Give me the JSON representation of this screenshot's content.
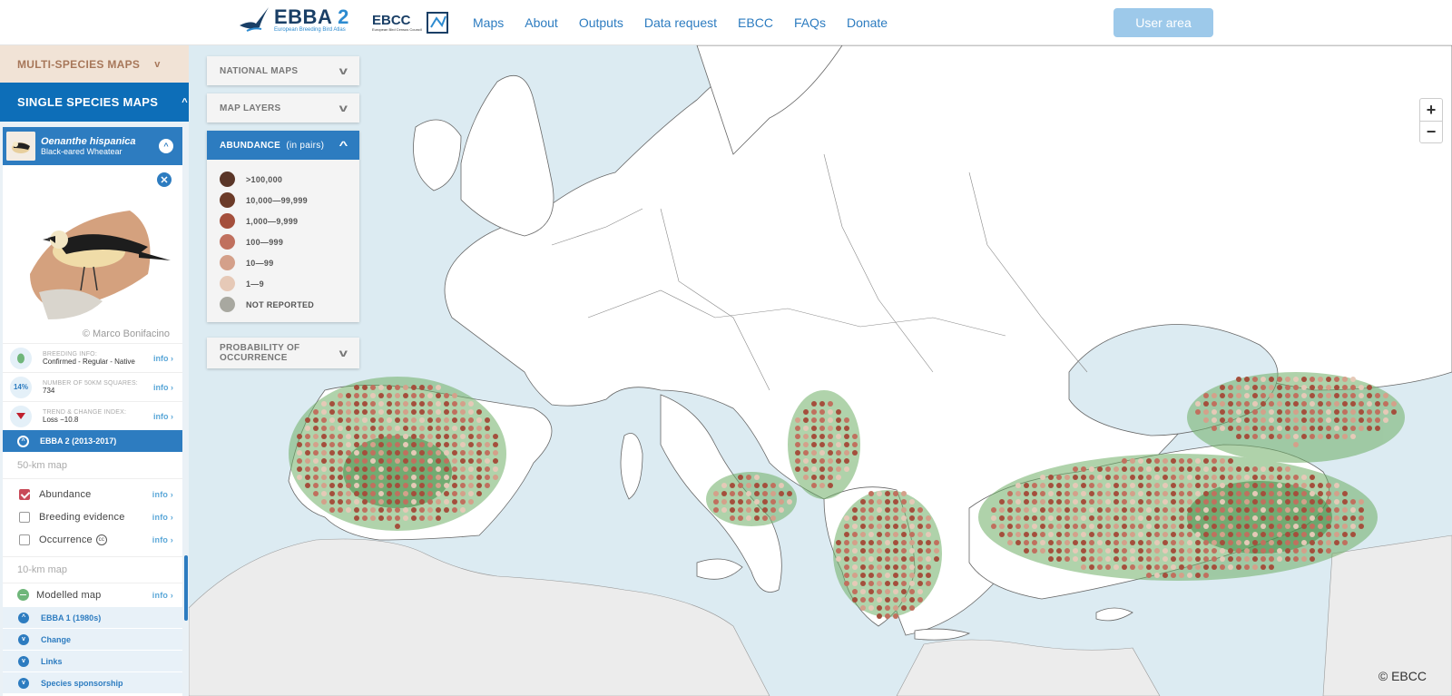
{
  "header": {
    "ebba_logo_main": "EBBA",
    "ebba_logo_num": "2",
    "ebba_logo_sub": "European Breeding Bird Atlas",
    "ebcc_logo": "EBCC",
    "ebcc_logo_sub": "European Bird Census Council",
    "nav": [
      "Maps",
      "About",
      "Outputs",
      "Data request",
      "EBCC",
      "FAQs",
      "Donate"
    ],
    "user_button": "User area"
  },
  "sidebar": {
    "multi_species": "MULTI-SPECIES MAPS",
    "single_species": "SINGLE SPECIES MAPS",
    "species": {
      "scientific": "Oenanthe hispanica",
      "common": "Black-eared Wheatear",
      "credit": "© Marco Bonifacino"
    },
    "info": [
      {
        "icon": "egg-icon",
        "label": "BREEDING INFO:",
        "value": "Confirmed - Regular - Native",
        "link": "info ›"
      },
      {
        "icon": "percent-badge",
        "badge": "14%",
        "label": "NUMBER OF 50KM SQUARES:",
        "value": "734",
        "link": "info ›"
      },
      {
        "icon": "trend-down-icon",
        "label": "TREND & CHANGE INDEX:",
        "value": "Loss −10.8",
        "link": "info ›"
      }
    ],
    "period": "EBBA 2 (2013-2017)",
    "map50_label": "50-km map",
    "map50_options": [
      {
        "label": "Abundance",
        "checked": true,
        "link": "info ›"
      },
      {
        "label": "Breeding evidence",
        "checked": false,
        "link": "info ›"
      },
      {
        "label": "Occurrence",
        "checked": false,
        "link": "info ›",
        "suffix": "cc"
      }
    ],
    "map10_label": "10-km map",
    "modelled": {
      "label": "Modelled map",
      "link": "info ›"
    },
    "sections": [
      "EBBA 1 (1980s)",
      "Change",
      "Links",
      "Species sponsorship"
    ]
  },
  "map_panels": {
    "national": "NATIONAL MAPS",
    "layers": "MAP LAYERS",
    "abundance_title": "ABUNDANCE",
    "abundance_unit": "(in pairs)",
    "probability": "PROBABILITY OF OCCURRENCE",
    "legend": [
      {
        "label": ">100,000",
        "color": "#5a3628"
      },
      {
        "label": "10,000—99,999",
        "color": "#6b3a28"
      },
      {
        "label": "1,000—9,999",
        "color": "#a44f3c"
      },
      {
        "label": "100—999",
        "color": "#c0705e"
      },
      {
        "label": "10—99",
        "color": "#d4a08a"
      },
      {
        "label": "1—9",
        "color": "#e6c9b7"
      },
      {
        "label": "NOT REPORTED",
        "color": "#a8a8a0"
      }
    ]
  },
  "map": {
    "zoom_in": "+",
    "zoom_out": "−",
    "copyright": "© EBCC",
    "colors": {
      "sea": "#dcebf2",
      "land": "#ffffff",
      "outside": "#ececec",
      "habitat": "#5f9e58",
      "dot": "#a44f3c"
    }
  }
}
